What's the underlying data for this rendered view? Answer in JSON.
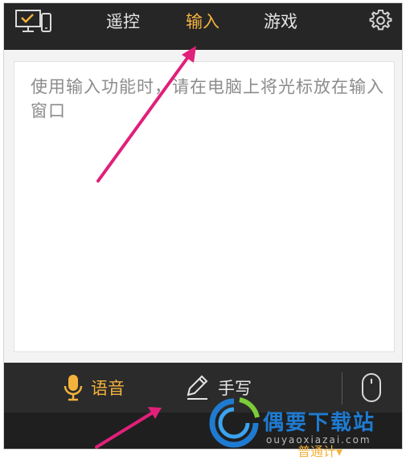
{
  "header": {
    "tabs": [
      {
        "label": "遥控",
        "active": false
      },
      {
        "label": "输入",
        "active": true
      },
      {
        "label": "游戏",
        "active": false
      }
    ]
  },
  "input": {
    "placeholder": "使用输入功能时，请在电脑上将光标放在输入窗口"
  },
  "bottom": {
    "voice_label": "语音",
    "handwrite_label": "手写"
  },
  "watermark": {
    "title": "偶要下载站",
    "url": "ouyaoxiazai.com",
    "stray": "普通计▾"
  },
  "colors": {
    "accent": "#f3b23c",
    "bar": "#262626",
    "arrow": "#e0207a"
  },
  "icons": [
    "device-icon",
    "gear-icon",
    "microphone-icon",
    "pencil-icon",
    "mouse-icon"
  ]
}
